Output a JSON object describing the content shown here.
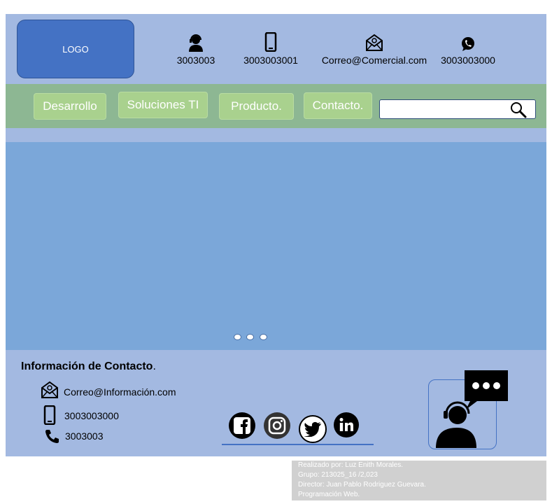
{
  "header": {
    "logo_text": "LOGO",
    "contacts": [
      {
        "icon": "headset-user-icon",
        "text": "3003003"
      },
      {
        "icon": "mobile-phone-icon",
        "text": "3003003001"
      },
      {
        "icon": "email-envelope-icon",
        "text": "Correo@Comercial.com"
      },
      {
        "icon": "whatsapp-icon",
        "text": "3003003000"
      }
    ]
  },
  "nav": {
    "items": [
      "Desarrollo",
      "Soluciones TI",
      "Producto.",
      "Contacto."
    ],
    "search": {
      "value": "",
      "placeholder": "",
      "icon": "search-icon"
    }
  },
  "hero": {
    "carousel_dots": 3
  },
  "footer": {
    "title": "Información de Contacto",
    "title_suffix": ".",
    "email": "Correo@Información.com",
    "mobile": "3003003000",
    "phone": "3003003",
    "social": [
      "facebook-icon",
      "instagram-icon",
      "twitter-icon",
      "linkedin-icon"
    ],
    "support_icon": "support-chat-icon"
  },
  "credits": {
    "line1": "Realizado por: Luz Enith Morales.",
    "line2": "Grupo: 213025_16 /2,023",
    "line3": "Director: Juan Pablo Rodriguez Guevara.",
    "line4": "Programación Web."
  },
  "colors": {
    "header_bg": "#a3b9e1",
    "logo_bg": "#4472c4",
    "nav_bg": "#8db793",
    "nav_button_bg": "#a9d18e",
    "hero_bg": "#7ba7d9",
    "credits_bg": "#d0d0d0"
  }
}
